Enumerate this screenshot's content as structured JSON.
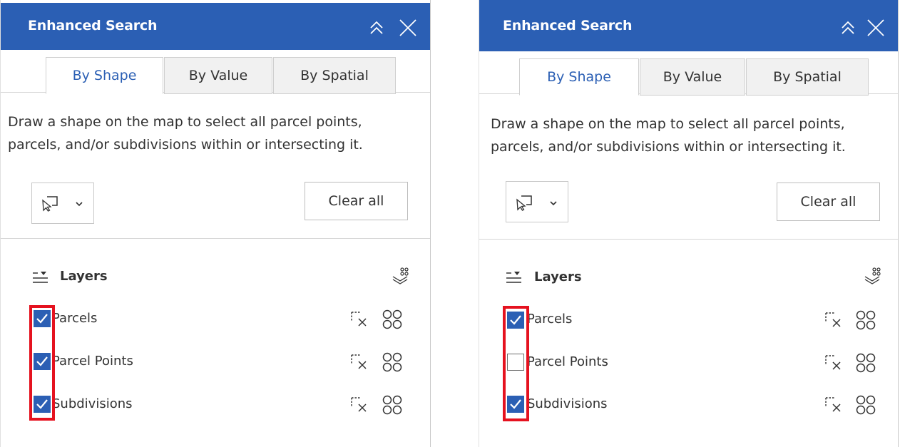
{
  "panels": [
    {
      "title": "Enhanced Search",
      "tabs": [
        {
          "label": "By Shape",
          "active": true
        },
        {
          "label": "By Value",
          "active": false
        },
        {
          "label": "By Spatial",
          "active": false
        }
      ],
      "description_lines": [
        "Draw a shape on the map to select all parcel points,",
        "parcels, and/or subdivisions within or intersecting it."
      ],
      "clear_label": "Clear all",
      "layers_title": "Layers",
      "layers": [
        {
          "label": "Parcels",
          "checked": true
        },
        {
          "label": "Parcel Points",
          "checked": true
        },
        {
          "label": "Subdivisions",
          "checked": true
        }
      ]
    },
    {
      "title": "Enhanced Search",
      "tabs": [
        {
          "label": "By Shape",
          "active": true
        },
        {
          "label": "By Value",
          "active": false
        },
        {
          "label": "By Spatial",
          "active": false
        }
      ],
      "description_lines": [
        "Draw a shape on the map to select all parcel points,",
        "parcels, and/or subdivisions within or intersecting it."
      ],
      "clear_label": "Clear all",
      "layers_title": "Layers",
      "layers": [
        {
          "label": "Parcels",
          "checked": true
        },
        {
          "label": "Parcel Points",
          "checked": false
        },
        {
          "label": "Subdivisions",
          "checked": true
        }
      ]
    }
  ],
  "colors": {
    "header": "#2b5fb4",
    "accent": "#2b5fb4",
    "highlight": "#e5121f"
  },
  "icons": {
    "collapse": "chevrons-up-icon",
    "close": "close-icon",
    "tool": "select-shape-icon",
    "layers": "layers-list-icon",
    "select_by": "select-layers-icon",
    "clear_selection": "clear-selection-icon",
    "select_all": "select-all-icon"
  }
}
